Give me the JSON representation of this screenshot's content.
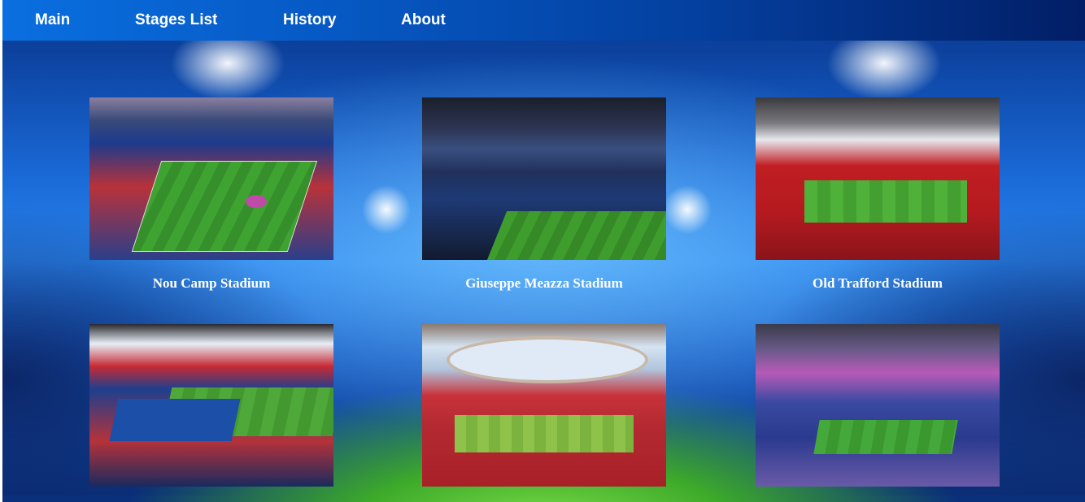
{
  "nav": {
    "items": [
      {
        "label": "Main"
      },
      {
        "label": "Stages List"
      },
      {
        "label": "History"
      },
      {
        "label": "About"
      }
    ]
  },
  "gallery": {
    "stadiums": [
      {
        "caption": "Nou Camp Stadium"
      },
      {
        "caption": "Giuseppe Meazza Stadium"
      },
      {
        "caption": "Old Trafford Stadium"
      },
      {
        "caption": ""
      },
      {
        "caption": ""
      },
      {
        "caption": ""
      }
    ]
  },
  "colors": {
    "nav_gradient_start": "#0a6fe0",
    "nav_gradient_end": "#021e66",
    "caption_text": "#ffffff",
    "pitch_green": "#3f9d2e"
  }
}
